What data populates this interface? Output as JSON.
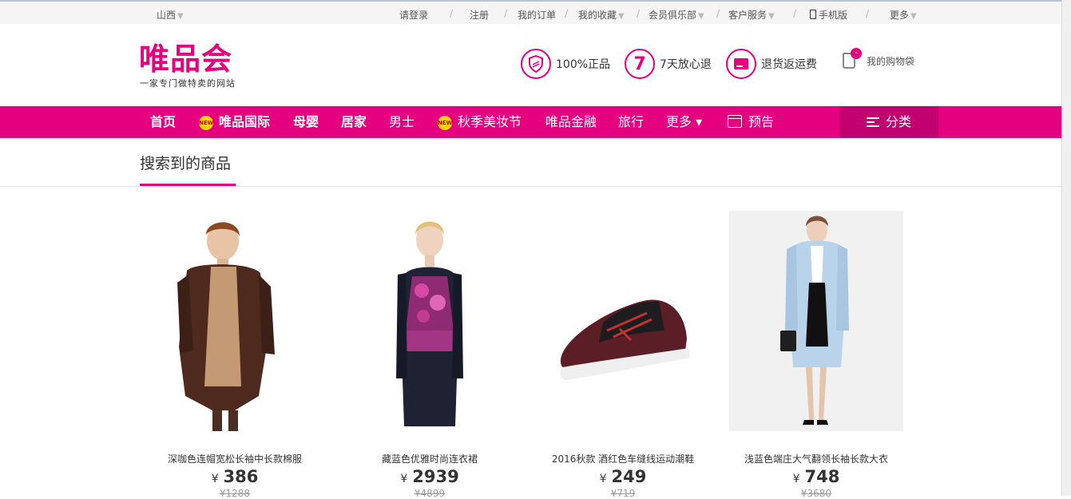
{
  "topbar": {
    "location": "山西",
    "login": "请登录",
    "register": "注册",
    "orders": "我的订单",
    "favorites": "我的收藏",
    "club": "会员俱乐部",
    "service": "客户服务",
    "mobile": "手机版",
    "more": "更多",
    "separator": "/"
  },
  "header": {
    "logo": "唯品会",
    "slogan": "一家专门做特卖的网站",
    "promises": [
      "100%正品",
      "7天放心退",
      "退货返运费"
    ],
    "seven": "7",
    "cart_label": "我的购物袋",
    "cart_count": "-"
  },
  "nav": {
    "items": [
      "首页",
      "唯品国际",
      "母婴",
      "居家",
      "男士",
      "秋季美妆节",
      "唯品金融",
      "旅行",
      "更多 ▾",
      "预告"
    ],
    "new_badge": "NEW",
    "category": "分类"
  },
  "section": {
    "title": "搜索到的商品"
  },
  "products": [
    {
      "name": "深咖色连帽宽松长袖中长款棉服",
      "currency": "¥",
      "price": "386",
      "original_price": "¥1288"
    },
    {
      "name": "藏蓝色优雅时尚连衣裙",
      "currency": "¥",
      "price": "2939",
      "original_price": "¥4899"
    },
    {
      "name": "2016秋款 酒红色车缝线运动潮鞋",
      "currency": "¥",
      "price": "249",
      "original_price": "¥719"
    },
    {
      "name": "浅蓝色端庄大气翻领长袖长款大衣",
      "currency": "¥",
      "price": "748",
      "original_price": "¥3680"
    }
  ],
  "colors": {
    "brand": "#e4007f",
    "category_bg": "#c20070",
    "topbar_bg": "#f5f5f5"
  }
}
